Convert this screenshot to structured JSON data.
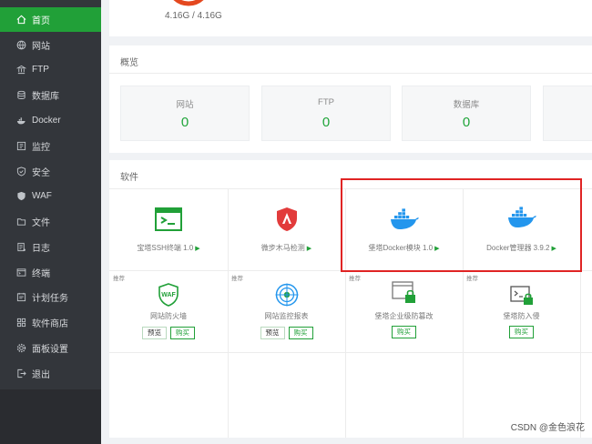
{
  "sidebar": {
    "items": [
      {
        "label": "首页",
        "icon": "home-icon",
        "active": true
      },
      {
        "label": "网站",
        "icon": "globe-icon"
      },
      {
        "label": "FTP",
        "icon": "ftp-icon"
      },
      {
        "label": "数据库",
        "icon": "database-icon"
      },
      {
        "label": "Docker",
        "icon": "docker-icon"
      },
      {
        "label": "监控",
        "icon": "monitor-icon"
      },
      {
        "label": "安全",
        "icon": "shield-icon"
      },
      {
        "label": "WAF",
        "icon": "waf-shield-icon"
      },
      {
        "label": "文件",
        "icon": "folder-icon"
      },
      {
        "label": "日志",
        "icon": "log-icon"
      },
      {
        "label": "终端",
        "icon": "terminal-icon"
      },
      {
        "label": "计划任务",
        "icon": "calendar-icon"
      },
      {
        "label": "软件商店",
        "icon": "grid-icon"
      },
      {
        "label": "面板设置",
        "icon": "gear-icon"
      },
      {
        "label": "退出",
        "icon": "logout-icon"
      }
    ]
  },
  "usage": {
    "disk": "4.16G / 4.16G"
  },
  "overview": {
    "title": "概览",
    "stats": [
      {
        "label": "网站",
        "value": "0"
      },
      {
        "label": "FTP",
        "value": "0"
      },
      {
        "label": "数据库",
        "value": "0"
      }
    ]
  },
  "software": {
    "title": "软件",
    "installed": [
      {
        "label": "宝塔SSH终端 1.0",
        "icon": "ssh-terminal-icon"
      },
      {
        "label": "微步木马检测",
        "icon": "trojan-detect-icon"
      },
      {
        "label": "堡塔Docker模块 1.0",
        "icon": "docker-whale-icon"
      },
      {
        "label": "Docker管理器 3.9.2",
        "icon": "docker-whale-icon"
      }
    ],
    "recommended": [
      {
        "tag": "推荐",
        "label": "网站防火墙",
        "icon": "waf-icon",
        "buttons": [
          "预览",
          "购买"
        ]
      },
      {
        "tag": "推荐",
        "label": "网站监控报表",
        "icon": "radar-icon",
        "buttons": [
          "预览",
          "购买"
        ]
      },
      {
        "tag": "推荐",
        "label": "堡塔企业级防篡改",
        "icon": "tamper-lock-icon",
        "buttons": [
          "购买"
        ]
      },
      {
        "tag": "推荐",
        "label": "堡塔防入侵",
        "icon": "intrusion-icon",
        "buttons": [
          "购买"
        ]
      }
    ]
  },
  "watermark": "CSDN @金色浪花",
  "colors": {
    "accent": "#20a53a",
    "sidebar": "#33363b",
    "highlight": "#e02424"
  }
}
